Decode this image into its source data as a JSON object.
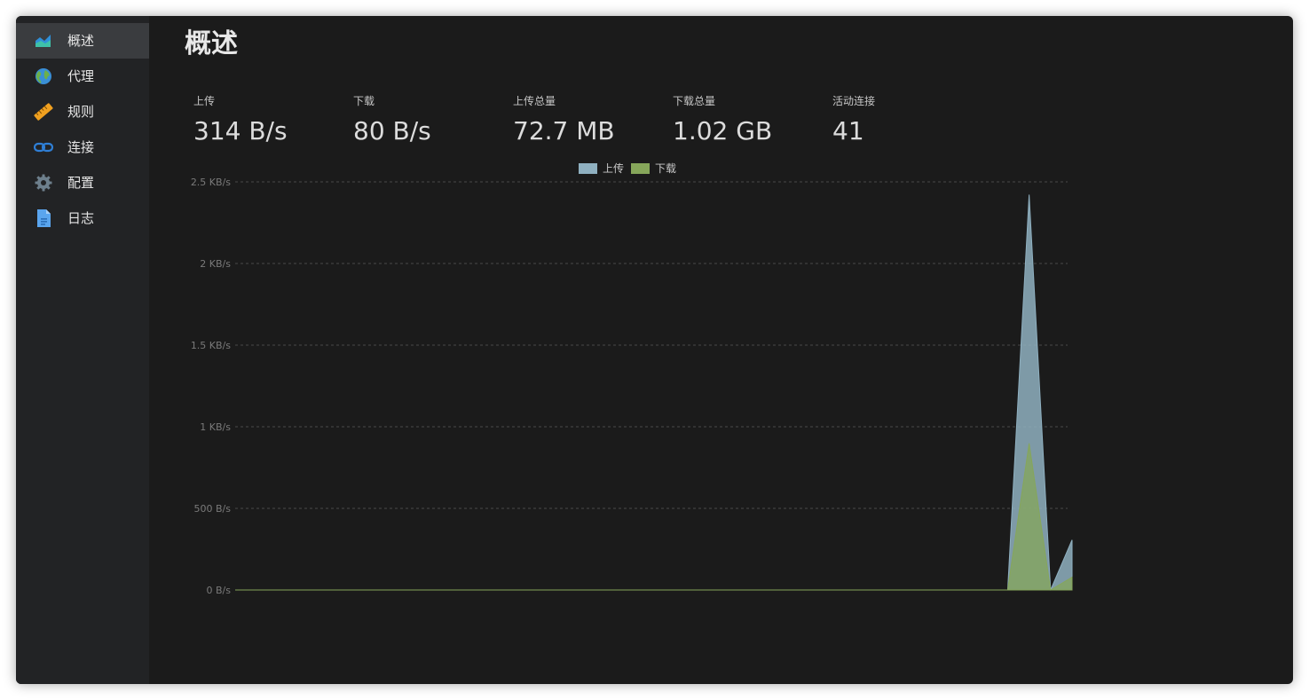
{
  "sidebar": {
    "items": [
      {
        "label": "概述",
        "icon": "area-chart-icon",
        "active": true
      },
      {
        "label": "代理",
        "icon": "globe-icon",
        "active": false
      },
      {
        "label": "规则",
        "icon": "ruler-icon",
        "active": false
      },
      {
        "label": "连接",
        "icon": "link-icon",
        "active": false
      },
      {
        "label": "配置",
        "icon": "gear-icon",
        "active": false
      },
      {
        "label": "日志",
        "icon": "document-icon",
        "active": false
      }
    ]
  },
  "main": {
    "title": "概述",
    "stats": [
      {
        "label": "上传",
        "value": "314 B/s"
      },
      {
        "label": "下载",
        "value": "80 B/s"
      },
      {
        "label": "上传总量",
        "value": "72.7 MB"
      },
      {
        "label": "下载总量",
        "value": "1.02 GB"
      },
      {
        "label": "活动连接",
        "value": "41"
      }
    ]
  },
  "colors": {
    "upload": "#8fb0c0",
    "download": "#86a65a",
    "background": "#1b1b1b",
    "sidebar": "#222325",
    "sidebar_active": "#3a3c3f"
  },
  "chart_data": {
    "type": "area",
    "legend": [
      "上传",
      "下载"
    ],
    "legend_position": "top-center",
    "y_ticks": [
      "0 B/s",
      "500 B/s",
      "1 KB/s",
      "1.5 KB/s",
      "2 KB/s",
      "2.5 KB/s"
    ],
    "ylim": [
      0,
      2560
    ],
    "grid": true,
    "x_count": 40,
    "series": [
      {
        "name": "上传",
        "values": [
          0,
          0,
          0,
          0,
          0,
          0,
          0,
          0,
          0,
          0,
          0,
          0,
          0,
          0,
          0,
          0,
          0,
          0,
          0,
          0,
          0,
          0,
          0,
          0,
          0,
          0,
          0,
          0,
          0,
          0,
          0,
          0,
          0,
          0,
          0,
          0,
          0,
          2480,
          0,
          314
        ]
      },
      {
        "name": "下载",
        "values": [
          0,
          0,
          0,
          0,
          0,
          0,
          0,
          0,
          0,
          0,
          0,
          0,
          0,
          0,
          0,
          0,
          0,
          0,
          0,
          0,
          0,
          0,
          0,
          0,
          0,
          0,
          0,
          0,
          0,
          0,
          0,
          0,
          0,
          0,
          0,
          0,
          0,
          920,
          0,
          80
        ]
      }
    ]
  }
}
